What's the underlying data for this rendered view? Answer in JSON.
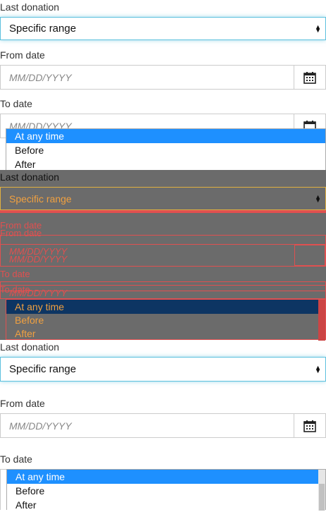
{
  "form": {
    "last_donation_label": "Last donation",
    "select_value": "Specific range",
    "from_date_label": "From date",
    "to_date_label": "To date",
    "date_placeholder": "MM/DD/YYYY"
  },
  "dropdown": {
    "options": [
      "At any time",
      "Before",
      "After"
    ],
    "selected": "At any time"
  },
  "colors": {
    "accent": "#1e90ff",
    "focus_border": "#5bc0de",
    "overlay": "#6b6b6b",
    "debug_outline": "#e05050"
  }
}
